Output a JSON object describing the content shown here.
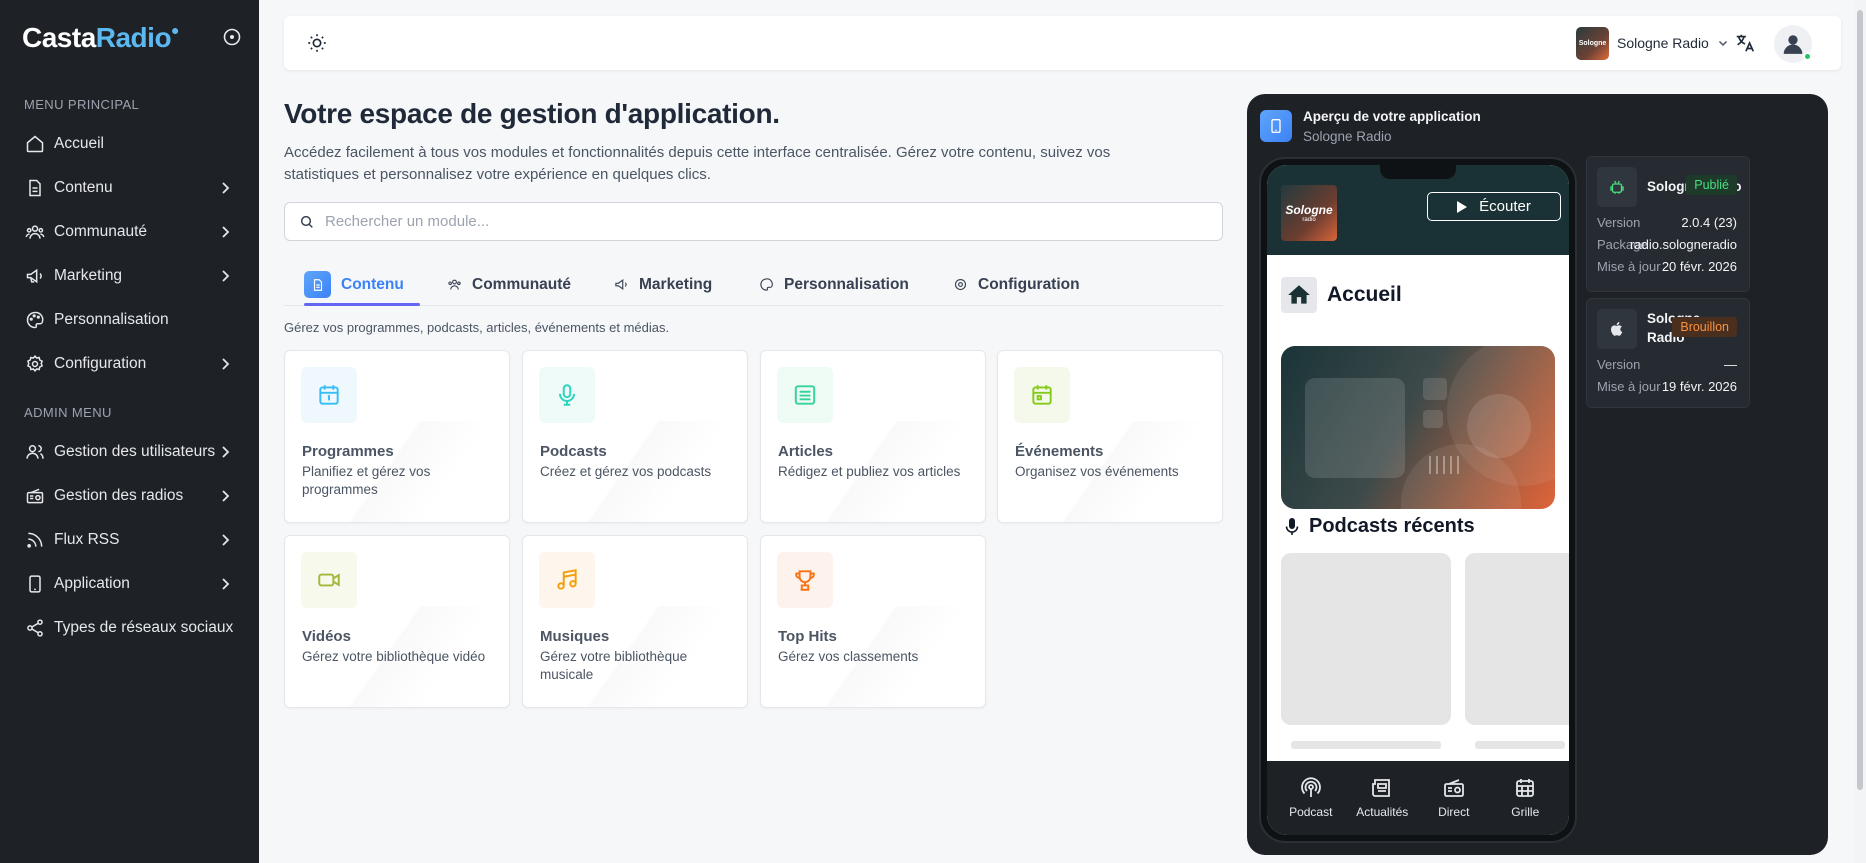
{
  "sidebar": {
    "logo": {
      "part1": "Casta",
      "part2": "Radio"
    },
    "main_menu_title": "MENU PRINCIPAL",
    "admin_menu_title": "ADMIN MENU",
    "main_items": [
      {
        "label": "Accueil",
        "icon": "home-icon",
        "has_chevron": false
      },
      {
        "label": "Contenu",
        "icon": "document-icon",
        "has_chevron": true
      },
      {
        "label": "Communauté",
        "icon": "users-icon",
        "has_chevron": true
      },
      {
        "label": "Marketing",
        "icon": "megaphone-icon",
        "has_chevron": true
      },
      {
        "label": "Personnalisation",
        "icon": "palette-icon",
        "has_chevron": false
      },
      {
        "label": "Configuration",
        "icon": "gear-icon",
        "has_chevron": true
      }
    ],
    "admin_items": [
      {
        "label": "Gestion des utilisateurs",
        "icon": "users-icon",
        "has_chevron": true
      },
      {
        "label": "Gestion des radios",
        "icon": "radio-icon",
        "has_chevron": true
      },
      {
        "label": "Flux RSS",
        "icon": "rss-icon",
        "has_chevron": true
      },
      {
        "label": "Application",
        "icon": "phone-icon",
        "has_chevron": true
      },
      {
        "label": "Types de réseaux sociaux",
        "icon": "share-icon",
        "has_chevron": false
      }
    ]
  },
  "topbar": {
    "station_name": "Sologne Radio",
    "station_thumb_text": "Sologne"
  },
  "main": {
    "title": "Votre espace de gestion d'application.",
    "description": "Accédez facilement à tous vos modules et fonctionnalités depuis cette interface centralisée. Gérez votre contenu, suivez vos statistiques et personnalisez votre expérience en quelques clics.",
    "search_placeholder": "Rechercher un module...",
    "tabs": [
      {
        "label": "Contenu",
        "icon": "document-icon",
        "active": true
      },
      {
        "label": "Communauté",
        "icon": "users-icon",
        "active": false
      },
      {
        "label": "Marketing",
        "icon": "megaphone-icon",
        "active": false
      },
      {
        "label": "Personnalisation",
        "icon": "palette-icon",
        "active": false
      },
      {
        "label": "Configuration",
        "icon": "gear-icon",
        "active": false
      }
    ],
    "tab_hint": "Gérez vos programmes, podcasts, articles, événements et médias.",
    "cards": [
      {
        "title": "Programmes",
        "desc": "Planifiez et gérez vos programmes",
        "icon": "calendar-icon",
        "color": "#38bdf8",
        "bg": "#eef8fd"
      },
      {
        "title": "Podcasts",
        "desc": "Créez et gérez vos podcasts",
        "icon": "microphone-icon",
        "color": "#2dd4bf",
        "bg": "#eefbf9"
      },
      {
        "title": "Articles",
        "desc": "Rédigez et publiez vos articles",
        "icon": "newspaper-icon",
        "color": "#34d399",
        "bg": "#effbf5"
      },
      {
        "title": "Événements",
        "desc": "Organisez vos événements",
        "icon": "calendar-icon",
        "color": "#84cc16",
        "bg": "#f4f9ec"
      },
      {
        "title": "Vidéos",
        "desc": "Gérez votre bibliothèque vidéo",
        "icon": "video-icon",
        "color": "#a3b83c",
        "bg": "#f7f9ec"
      },
      {
        "title": "Musiques",
        "desc": "Gérez votre bibliothèque musicale",
        "icon": "music-icon",
        "color": "#f59e0b",
        "bg": "#fef6ec"
      },
      {
        "title": "Top Hits",
        "desc": "Gérez vos classements",
        "icon": "trophy-icon",
        "color": "#f97316",
        "bg": "#fef2ec"
      }
    ]
  },
  "preview": {
    "title": "Aperçu de votre application",
    "subtitle": "Sologne Radio",
    "app": {
      "logo_line1": "Sologne",
      "logo_line2": "radio",
      "listen_label": "Écouter",
      "home_label": "Accueil",
      "podcasts_label": "Podcasts récents",
      "bottom_nav": [
        {
          "label": "Podcast",
          "icon": "podcast-icon"
        },
        {
          "label": "Actualités",
          "icon": "newspaper-icon"
        },
        {
          "label": "Direct",
          "icon": "radio-icon"
        },
        {
          "label": "Grille",
          "icon": "calendar-icon"
        }
      ]
    },
    "android": {
      "name": "Sologne Radio",
      "badge": "Publié",
      "rows": [
        {
          "label": "Version",
          "value": "2.0.4 (23)"
        },
        {
          "label": "Package",
          "value": "radio.sologneradio"
        },
        {
          "label": "Mise à jour",
          "value": "20 févr. 2026"
        }
      ]
    },
    "ios": {
      "name_line1": "Sologne",
      "name_line2": "Radio",
      "badge": "Brouillon",
      "rows": [
        {
          "label": "Version",
          "value": "—"
        },
        {
          "label": "Mise à jour",
          "value": "19 févr. 2026"
        }
      ]
    }
  },
  "colors": {
    "sidebar_bg": "#1e2227",
    "accent": "#3b82f6",
    "tab_underline": "#6366f1",
    "badge_published": "#4ade80",
    "badge_draft": "#fb923c"
  }
}
